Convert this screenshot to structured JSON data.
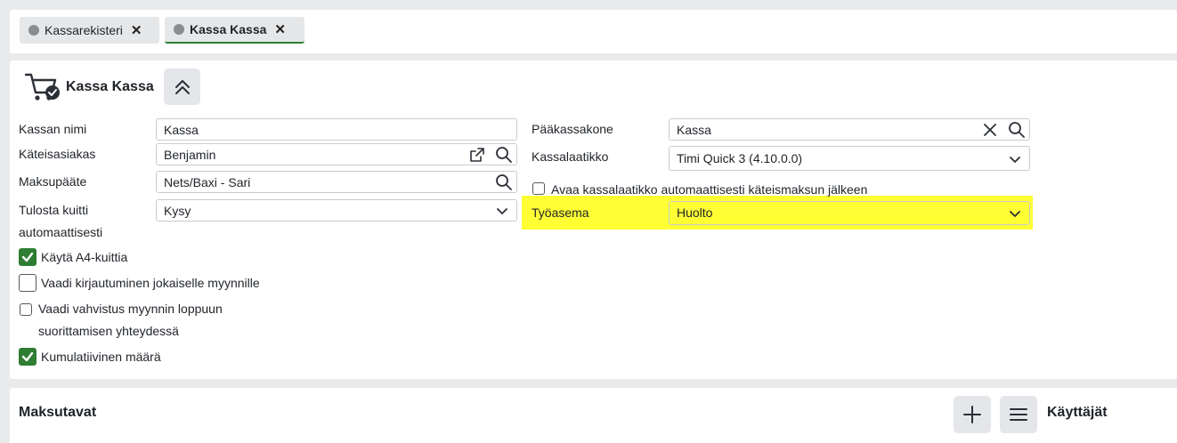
{
  "tabs": [
    {
      "label": "Kassarekisteri",
      "close": "✕"
    },
    {
      "label": "Kassa Kassa",
      "close": "✕"
    }
  ],
  "panel": {
    "title": "Kassa Kassa",
    "left": {
      "kassan_nimi": {
        "label": "Kassan nimi",
        "value": "Kassa"
      },
      "kateisasiakas": {
        "label": "Käteisasiakas",
        "value": "Benjamin"
      },
      "maksupaate": {
        "label": "Maksupääte",
        "value": "Nets/Baxi - Sari"
      },
      "tulosta_kuitti": {
        "label_line1": "Tulosta kuitti",
        "label_line2": "automaattisesti",
        "value": "Kysy"
      }
    },
    "right": {
      "paakassakone": {
        "label": "Pääkassakone",
        "value": "Kassa"
      },
      "kassalaatikko": {
        "label": "Kassalaatikko",
        "value": "Timi Quick 3 (4.10.0.0)"
      },
      "avaa_kassalaatikko": {
        "label": "Avaa kassalaatikko automaattisesti käteismaksun jälkeen",
        "checked": false
      },
      "tyoasema": {
        "label": "Työasema",
        "value": "Huolto"
      }
    },
    "checkboxes": {
      "a4": {
        "label": "Käytä A4-kuittia",
        "checked": true
      },
      "kirjautuminen": {
        "label": "Vaadi kirjautuminen jokaiselle myynnille",
        "checked": false
      },
      "vahvistus": {
        "label_line1": "Vaadi vahvistus myynnin loppuun",
        "label_line2": "suorittamisen yhteydessä",
        "checked": false
      },
      "kumulatiivinen": {
        "label": "Kumulatiivinen määrä",
        "checked": true
      }
    }
  },
  "bottom": {
    "maksutavat_title": "Maksutavat",
    "kayttajat_title": "Käyttäjät"
  },
  "colors": {
    "accent_green": "#2e7d32",
    "highlight": "#ffff33"
  }
}
